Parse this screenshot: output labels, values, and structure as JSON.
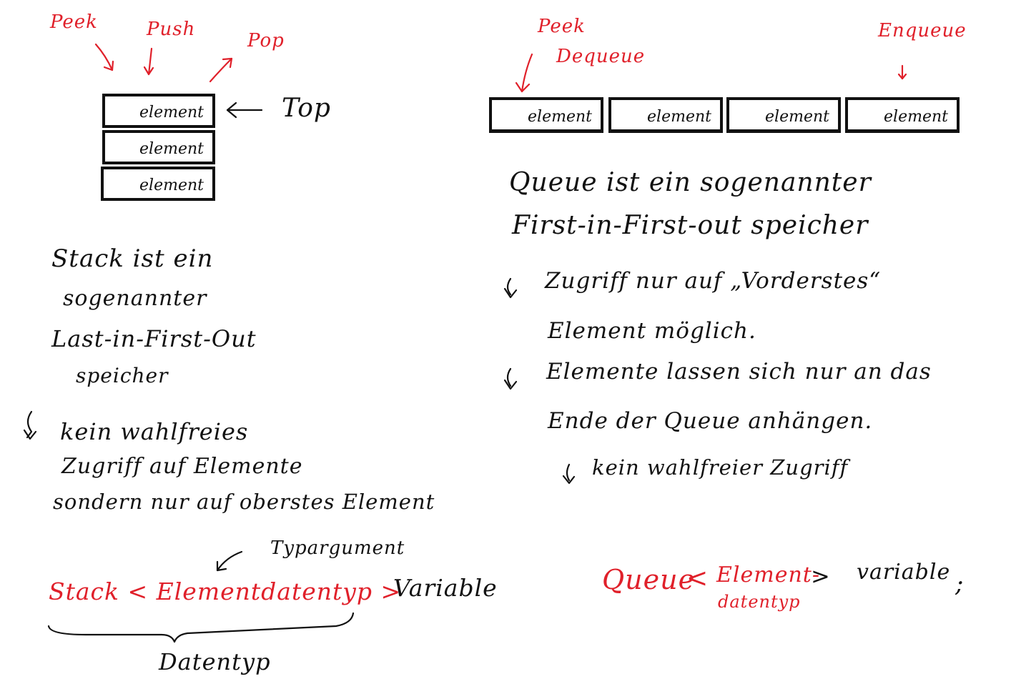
{
  "stack": {
    "ops": {
      "peek": "Peek",
      "push": "Push",
      "pop": "Pop"
    },
    "elements": [
      "element",
      "element",
      "element"
    ],
    "top_label": "Top",
    "text_lines": [
      "Stack ist ein",
      "sogenannter",
      "Last-in-First-Out",
      "speicher"
    ],
    "note_lines": [
      "kein wahlfreies",
      "Zugriff auf Elemente",
      "sondern nur auf oberstes Element"
    ],
    "type_argument_label": "Typargument",
    "declaration": {
      "type": "Stack < Elementdatentyp >",
      "variable": "Variable"
    },
    "datatype_label": "Datentyp"
  },
  "queue": {
    "ops": {
      "peek": "Peek",
      "dequeue": "Dequeue",
      "enqueue": "Enqueue"
    },
    "elements": [
      "element",
      "element",
      "element",
      "element"
    ],
    "text_lines": [
      "Queue ist ein sogenannter",
      "First-in-First-out speicher"
    ],
    "note1_lines": [
      "Zugriff nur auf „Vorderstes“",
      "Element möglich."
    ],
    "note2_lines": [
      "Elemente lassen sich nur an das",
      "Ende der Queue anhängen."
    ],
    "note3": "kein wahlfreier Zugriff",
    "declaration": {
      "type_start": "Queue",
      "open": "<",
      "element_type": "Element-",
      "element_type_2": "datentyp",
      "close": ">",
      "variable": "variable",
      "semicolon": ";"
    }
  },
  "colors": {
    "ink": "#111111",
    "red_ink": "#e0202a",
    "paper": "#ffffff"
  }
}
